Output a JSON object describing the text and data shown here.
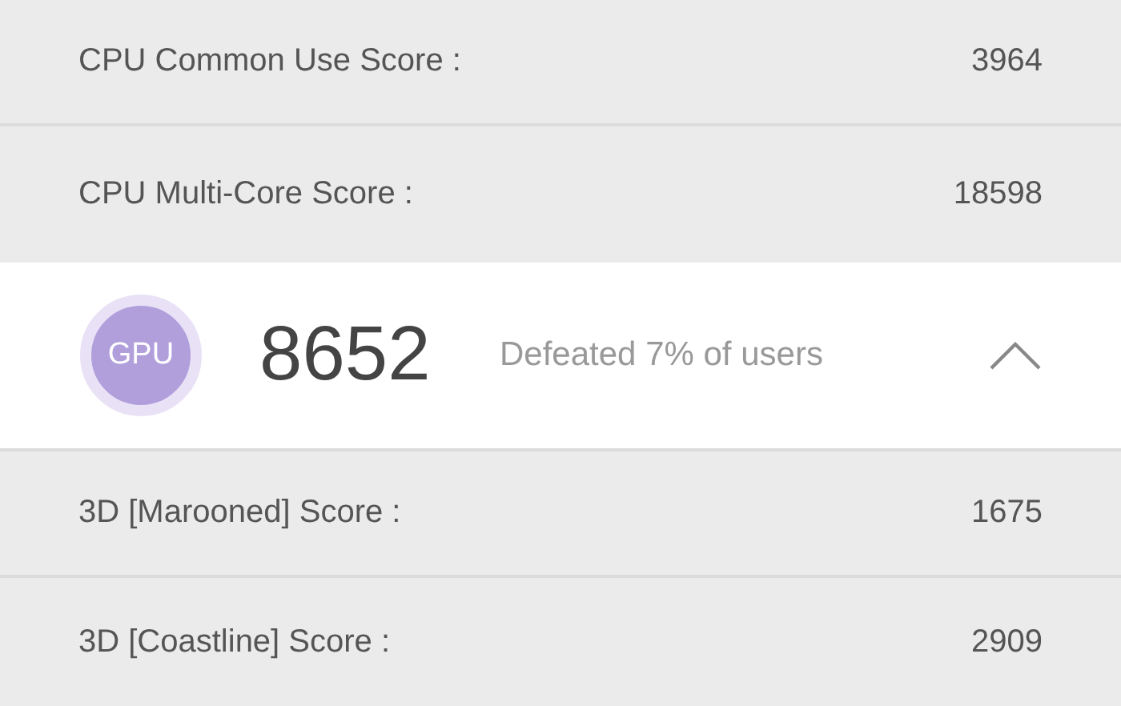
{
  "cpu_scores": [
    {
      "label": "CPU Common Use Score :",
      "value": "3964"
    },
    {
      "label": "CPU Multi-Core Score :",
      "value": "18598"
    }
  ],
  "gpu": {
    "badge": "GPU",
    "score": "8652",
    "summary": "Defeated 7% of users",
    "expanded": true,
    "scores": [
      {
        "label": "3D [Marooned] Score :",
        "value": "1675"
      },
      {
        "label": "3D [Coastline] Score :",
        "value": "2909"
      }
    ]
  }
}
